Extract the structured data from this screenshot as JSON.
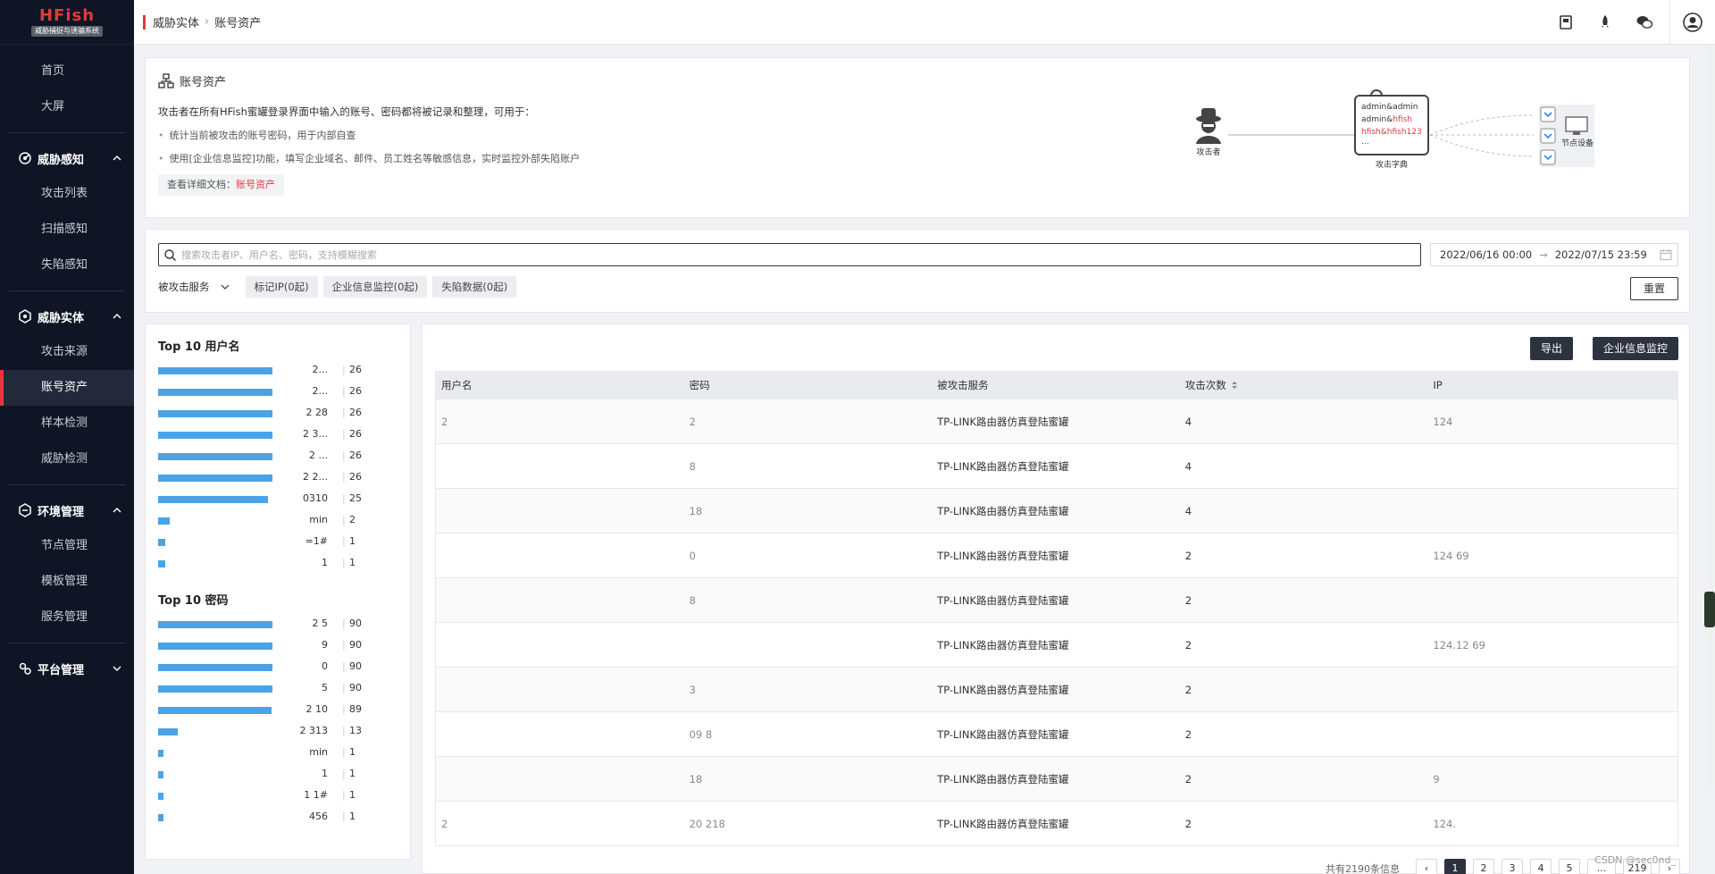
{
  "app": {
    "logo_title": "HFish",
    "logo_subtitle": "威胁捕捉与诱骗系统"
  },
  "sidebar": {
    "top_items": [
      {
        "label": "首页"
      },
      {
        "label": "大屏"
      }
    ],
    "groups": [
      {
        "title": "威胁感知",
        "items": [
          "攻击列表",
          "扫描感知",
          "失陷感知"
        ]
      },
      {
        "title": "威胁实体",
        "items": [
          "攻击来源",
          "账号资产",
          "样本检测",
          "威胁检测"
        ]
      },
      {
        "title": "环境管理",
        "items": [
          "节点管理",
          "模板管理",
          "服务管理"
        ]
      },
      {
        "title": "平台管理",
        "items": []
      }
    ],
    "active_item": "账号资产"
  },
  "breadcrumb": {
    "parent": "威胁实体",
    "current": "账号资产"
  },
  "intro": {
    "title": "账号资产",
    "description": "攻击者在所有HFish蜜罐登录界面中输入的账号、密码都将被记录和整理，可用于：",
    "bullets": [
      "统计当前被攻击的账号密码，用于内部自查",
      "使用[企业信息监控]功能，填写企业域名、邮件、员工姓名等敏感信息，实时监控外部失陷账户"
    ],
    "doc_prefix": "查看详细文档：",
    "doc_link": "账号资产",
    "diagram": {
      "attacker_label": "攻击者",
      "dict_lines": [
        "admin&admin",
        "admin&",
        "hfish",
        "hfish&hfish123",
        "..."
      ],
      "dict_label": "攻击字典",
      "node_label": "节点设备"
    }
  },
  "filter": {
    "search_placeholder": "搜索攻击者IP、用户名、密码，支持模糊搜索",
    "date_start": "2022/06/16 00:00",
    "date_arrow": "→",
    "date_end": "2022/07/15 23:59",
    "service_select": "被攻击服务",
    "chips": [
      "标记IP(0起)",
      "企业信息监控(0起)",
      "失陷数据(0起)"
    ],
    "reset_label": "重置"
  },
  "top10_usernames": {
    "title": "Top 10 用户名",
    "items": [
      {
        "label": "2...",
        "count": 26,
        "ratio": 1.0
      },
      {
        "label": "2...",
        "count": 26,
        "ratio": 1.0
      },
      {
        "label": "2 28",
        "count": 26,
        "ratio": 1.0
      },
      {
        "label": "2 3...",
        "count": 26,
        "ratio": 1.0
      },
      {
        "label": "2 ...",
        "count": 26,
        "ratio": 1.0
      },
      {
        "label": "2 2...",
        "count": 26,
        "ratio": 1.0
      },
      {
        "label": "0310",
        "count": 25,
        "ratio": 0.96
      },
      {
        "label": "min",
        "count": 2,
        "ratio": 0.1
      },
      {
        "label": "=1#",
        "count": 1,
        "ratio": 0.06
      },
      {
        "label": "1",
        "count": 1,
        "ratio": 0.06
      }
    ]
  },
  "top10_passwords": {
    "title": "Top 10 密码",
    "items": [
      {
        "label": "2 5",
        "count": 90,
        "ratio": 1.0
      },
      {
        "label": "9",
        "count": 90,
        "ratio": 1.0
      },
      {
        "label": "0",
        "count": 90,
        "ratio": 1.0
      },
      {
        "label": "5",
        "count": 90,
        "ratio": 1.0
      },
      {
        "label": "2 10",
        "count": 89,
        "ratio": 0.99
      },
      {
        "label": "2 313",
        "count": 13,
        "ratio": 0.17
      },
      {
        "label": "min",
        "count": 1,
        "ratio": 0.03
      },
      {
        "label": "1",
        "count": 1,
        "ratio": 0.03
      },
      {
        "label": "1 1#",
        "count": 1,
        "ratio": 0.03
      },
      {
        "label": "456",
        "count": 1,
        "ratio": 0.03
      }
    ]
  },
  "table": {
    "export_label": "导出",
    "monitor_label": "企业信息监控",
    "columns": [
      "用户名",
      "密码",
      "被攻击服务",
      "攻击次数",
      "IP"
    ],
    "rows": [
      {
        "username": "2",
        "password": "2",
        "service": "TP-LINK路由器仿真登陆蜜罐",
        "count": "4",
        "ip": "124"
      },
      {
        "username": "",
        "password": "8",
        "service": "TP-LINK路由器仿真登陆蜜罐",
        "count": "4",
        "ip": ""
      },
      {
        "username": "",
        "password": "18",
        "service": "TP-LINK路由器仿真登陆蜜罐",
        "count": "4",
        "ip": ""
      },
      {
        "username": "",
        "password": "0",
        "service": "TP-LINK路由器仿真登陆蜜罐",
        "count": "2",
        "ip": "124 69"
      },
      {
        "username": "",
        "password": "8",
        "service": "TP-LINK路由器仿真登陆蜜罐",
        "count": "2",
        "ip": ""
      },
      {
        "username": "",
        "password": "",
        "service": "TP-LINK路由器仿真登陆蜜罐",
        "count": "2",
        "ip": "124.12 69"
      },
      {
        "username": "",
        "password": "3",
        "service": "TP-LINK路由器仿真登陆蜜罐",
        "count": "2",
        "ip": ""
      },
      {
        "username": "",
        "password": "09 8",
        "service": "TP-LINK路由器仿真登陆蜜罐",
        "count": "2",
        "ip": ""
      },
      {
        "username": "",
        "password": "18",
        "service": "TP-LINK路由器仿真登陆蜜罐",
        "count": "2",
        "ip": "9"
      },
      {
        "username": "2",
        "password": "20 218",
        "service": "TP-LINK路由器仿真登陆蜜罐",
        "count": "2",
        "ip": "124."
      }
    ]
  },
  "pagination": {
    "total_text": "共有2190条信息",
    "pages": [
      "1",
      "2",
      "3",
      "4",
      "5",
      "...",
      "219"
    ],
    "current": "1"
  },
  "watermark": "CSDN @sec0nd_",
  "colors": {
    "sidebar_bg": "#0f1524",
    "accent_red": "#e4393c",
    "bar_blue": "#4ba3e7",
    "button_dark": "#2d323f"
  }
}
